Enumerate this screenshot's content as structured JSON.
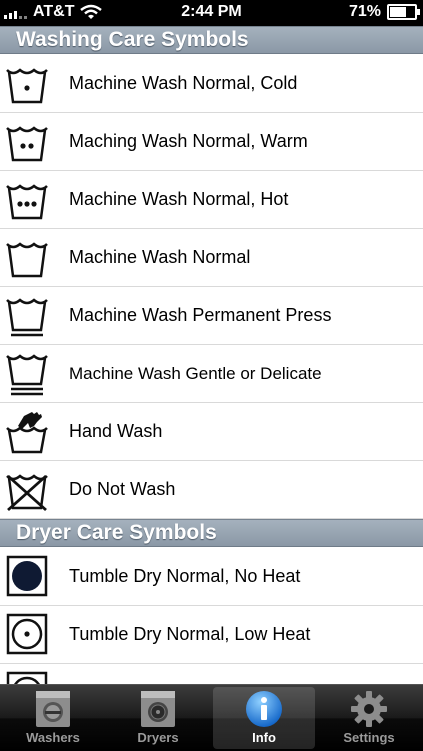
{
  "status": {
    "carrier": "AT&T",
    "time": "2:44 PM",
    "battery": "71%",
    "battery_level": 0.71
  },
  "sections": [
    {
      "title": "Washing Care Symbols",
      "items": [
        {
          "label": "Machine Wash Normal, Cold",
          "icon": "wash-1dot-icon"
        },
        {
          "label": "Maching Wash Normal, Warm",
          "icon": "wash-2dots-icon"
        },
        {
          "label": "Machine Wash Normal, Hot",
          "icon": "wash-3dots-icon"
        },
        {
          "label": "Machine Wash Normal",
          "icon": "wash-tub-icon"
        },
        {
          "label": "Machine Wash Permanent Press",
          "icon": "wash-permanent-press-icon"
        },
        {
          "label": "Machine Wash Gentle or Delicate",
          "icon": "wash-gentle-icon"
        },
        {
          "label": "Hand Wash",
          "icon": "hand-wash-icon"
        },
        {
          "label": "Do Not Wash",
          "icon": "do-not-wash-icon"
        }
      ]
    },
    {
      "title": "Dryer Care Symbols",
      "items": [
        {
          "label": "Tumble Dry Normal, No Heat",
          "icon": "tumble-dry-no-heat-icon"
        },
        {
          "label": "Tumble Dry Normal, Low Heat",
          "icon": "tumble-dry-low-heat-icon"
        }
      ]
    }
  ],
  "tabs": [
    {
      "label": "Washers",
      "icon": "washer-icon",
      "active": false
    },
    {
      "label": "Dryers",
      "icon": "dryer-icon",
      "active": false
    },
    {
      "label": "Info",
      "icon": "info-icon",
      "active": true
    },
    {
      "label": "Settings",
      "icon": "gear-icon",
      "active": false
    }
  ]
}
